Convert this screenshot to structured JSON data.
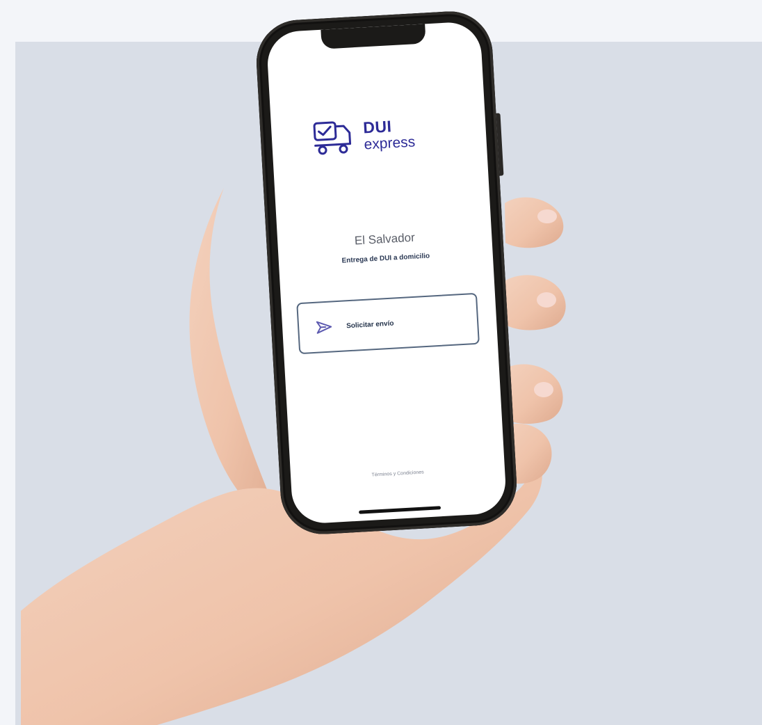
{
  "app": {
    "brand_primary": "DUI",
    "brand_secondary": "express",
    "country": "El Salvador",
    "subtitle": "Entrega de DUI a domicilio",
    "request_button_label": "Solicitar envío",
    "terms_link": "Términos y Condiciones"
  },
  "icons": {
    "logo": "delivery-truck-id-icon",
    "request": "send-arrow-icon"
  },
  "colors": {
    "background": "#f3f5f9",
    "backdrop": "#d9dee7",
    "brand": "#2d2b97",
    "button_border": "#55677f",
    "phone_frame": "#1b1a18",
    "skin": "#efc6ad"
  }
}
